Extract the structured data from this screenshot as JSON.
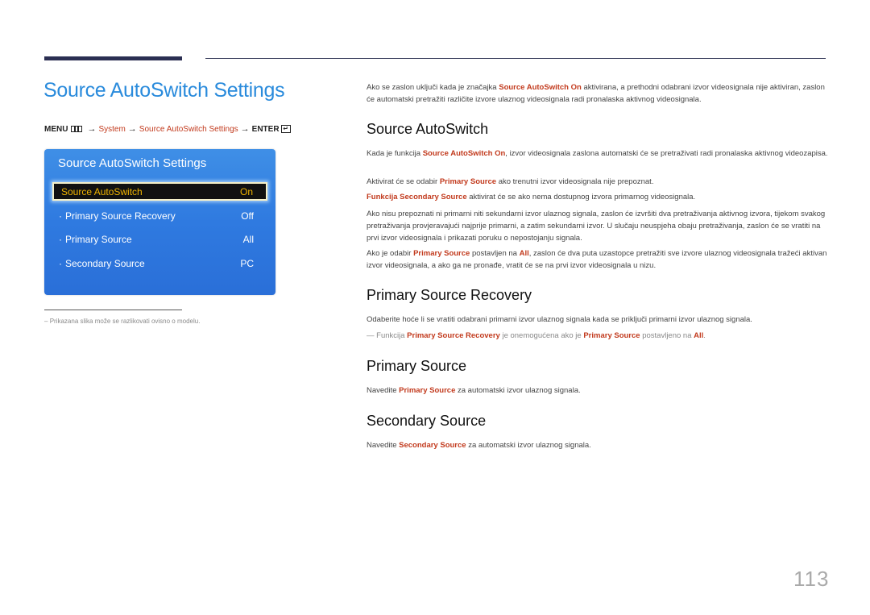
{
  "page_title": "Source AutoSwitch Settings",
  "breadcrumb": {
    "menu": "MENU",
    "arrow": "→",
    "items": [
      "System",
      "Source AutoSwitch Settings"
    ],
    "enter": "ENTER",
    "enter_glyph": "↵"
  },
  "osd": {
    "title": "Source AutoSwitch Settings",
    "bullet": "·",
    "items": [
      {
        "label": "Source AutoSwitch",
        "value": "On",
        "selected": true
      },
      {
        "label": "Primary Source Recovery",
        "value": "Off"
      },
      {
        "label": "Primary Source",
        "value": "All"
      },
      {
        "label": "Secondary Source",
        "value": "PC"
      }
    ]
  },
  "footnote": {
    "dash": "–",
    "text": "Prikazana slika može se razlikovati ovisno o modelu."
  },
  "intro": {
    "pre": "Ako se zaslon uključi kada je značajka ",
    "hl": "Source AutoSwitch On",
    "post": " aktivirana, a prethodni odabrani izvor videosignala nije aktiviran, zaslon će automatski pretražiti različite izvore ulaznog videosignala radi pronalaska aktivnog videosignala."
  },
  "sections": {
    "autoswitch": {
      "heading": "Source AutoSwitch",
      "p1_pre": "Kada je funkcija ",
      "p1_hl": "Source AutoSwitch On",
      "p1_post": ", izvor videosignala zaslona automatski će se pretraživati radi pronalaska aktivnog videozapisa.",
      "p2_pre": "Aktivirat će se odabir ",
      "p2_hl": "Primary Source",
      "p2_post": " ako trenutni izvor videosignala nije prepoznat.",
      "p3_hl": "Funkcija Secondary Source",
      "p3_post": " aktivirat će se ako nema dostupnog izvora primarnog videosignala.",
      "p4": "Ako nisu prepoznati ni primarni niti sekundarni izvor ulaznog signala, zaslon će izvršiti dva pretraživanja aktivnog izvora, tijekom svakog pretraživanja provjeravajući najprije primarni, a zatim sekundarni izvor. U slučaju neuspjeha obaju pretraživanja, zaslon će se vratiti na prvi izvor videosignala i prikazati poruku o nepostojanju signala.",
      "p5_pre": "Ako je odabir ",
      "p5_hl1": "Primary Source",
      "p5_mid": " postavljen na ",
      "p5_hl2": "All",
      "p5_post": ", zaslon će dva puta uzastopce pretražiti sve izvore ulaznog videosignala tražeći aktivan izvor videosignala, a ako ga ne pronađe, vratit će se na prvi izvor videosignala u nizu."
    },
    "recovery": {
      "heading": "Primary Source Recovery",
      "p1": "Odaberite hoće li se vratiti odabrani primarni izvor ulaznog signala kada se priključi primarni izvor ulaznog signala.",
      "note_dash": "—",
      "note_pre": " Funkcija ",
      "note_hl1": "Primary Source Recovery",
      "note_mid": " je onemogućena ako je ",
      "note_hl2": "Primary Source",
      "note_mid2": " postavljeno na ",
      "note_hl3": "All",
      "note_post": "."
    },
    "primary": {
      "heading": "Primary Source",
      "pre": "Navedite ",
      "hl": "Primary Source",
      "post": " za automatski izvor ulaznog signala."
    },
    "secondary": {
      "heading": "Secondary Source",
      "pre": "Navedite ",
      "hl": "Secondary Source",
      "post": " za automatski izvor ulaznog signala."
    }
  },
  "page_number": "113",
  "colors": {
    "title_blue": "#2a8bdc",
    "highlight_red": "#c23a1d",
    "osd_blue": "#2f7ae0",
    "osd_selected_text": "#f0b400"
  }
}
